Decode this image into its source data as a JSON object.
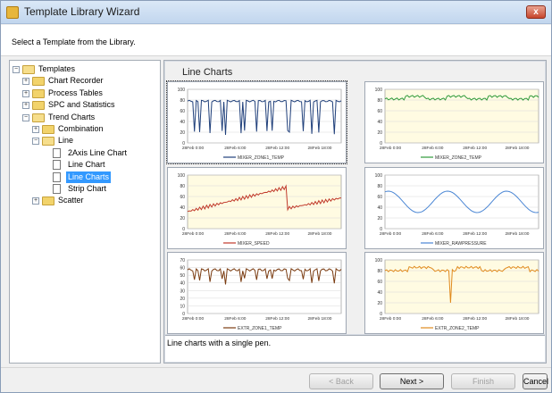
{
  "window": {
    "title": "Template Library Wizard",
    "close_glyph": "x"
  },
  "header": {
    "text": "Select a Template from the Library."
  },
  "tree": {
    "items": [
      {
        "label": "Templates",
        "level": 0,
        "expander": "−",
        "icon": "folder-open-icon"
      },
      {
        "label": "Chart Recorder",
        "level": 1,
        "expander": "+",
        "icon": "folder-icon"
      },
      {
        "label": "Process Tables",
        "level": 1,
        "expander": "+",
        "icon": "folder-icon"
      },
      {
        "label": "SPC and Statistics",
        "level": 1,
        "expander": "+",
        "icon": "folder-icon"
      },
      {
        "label": "Trend Charts",
        "level": 1,
        "expander": "−",
        "icon": "folder-open-icon"
      },
      {
        "label": "Combination",
        "level": 2,
        "expander": "+",
        "icon": "folder-icon"
      },
      {
        "label": "Line",
        "level": 2,
        "expander": "−",
        "icon": "folder-open-icon"
      },
      {
        "label": "2Axis Line Chart",
        "level": 3,
        "expander": "",
        "icon": "document-icon"
      },
      {
        "label": "Line Chart",
        "level": 3,
        "expander": "",
        "icon": "document-icon"
      },
      {
        "label": "Line Charts",
        "level": 3,
        "expander": "",
        "icon": "document-icon",
        "selected": true
      },
      {
        "label": "Strip Chart",
        "level": 3,
        "expander": "",
        "icon": "document-icon"
      },
      {
        "label": "Scatter",
        "level": 2,
        "expander": "+",
        "icon": "folder-icon"
      }
    ]
  },
  "gallery": {
    "title": "Line Charts",
    "description": "Line charts with a single pen."
  },
  "buttons": {
    "back": "< Back",
    "next": "Next >",
    "finish": "Finish",
    "cancel": "Cancel"
  },
  "chart_data": [
    {
      "type": "line",
      "pattern": "spiky-down",
      "ylim": [
        0,
        100
      ],
      "yticks": [
        "0",
        "20",
        "40",
        "60",
        "80",
        "100"
      ],
      "xticks": [
        "28Feb 0:00",
        "28Feb 6:00",
        "28Feb 12:00",
        "28Feb 18:00"
      ],
      "legend": "MIXER_ZONE1_TEMP",
      "color": "#1f3f7a",
      "base": 78,
      "low": 15,
      "bg": "#ffffff"
    },
    {
      "type": "line",
      "pattern": "steppy",
      "ylim": [
        0,
        100
      ],
      "yticks": [
        "0",
        "20",
        "40",
        "60",
        "80",
        "100"
      ],
      "xticks": [
        "28Feb 0:00",
        "28Feb 6:00",
        "28Feb 12:00",
        "28Feb 18:00"
      ],
      "legend": "MIXER_ZONE2_TEMP",
      "color": "#2e9a3a",
      "base": 82,
      "low": 78,
      "bg": "#fffbe2"
    },
    {
      "type": "line",
      "pattern": "ramp-drop",
      "ylim": [
        0,
        100
      ],
      "yticks": [
        "0",
        "20",
        "40",
        "60",
        "80",
        "100"
      ],
      "xticks": [
        "28Feb 0:00",
        "28Feb 6:00",
        "28Feb 12:00",
        "28Feb 18:00"
      ],
      "legend": "MIXER_SPEED",
      "color": "#c0392b",
      "base": 32,
      "low": 80,
      "bg": "#fffbe2"
    },
    {
      "type": "line",
      "pattern": "sine",
      "ylim": [
        0,
        100
      ],
      "yticks": [
        "0",
        "20",
        "40",
        "60",
        "80",
        "100"
      ],
      "xticks": [
        "28Feb 0:00",
        "28Feb 6:00",
        "28Feb 12:00",
        "28Feb 18:00"
      ],
      "legend": "MIXER_RAWPRESSURE",
      "color": "#4a86d4",
      "base": 60,
      "low": 40,
      "bg": "#ffffff"
    },
    {
      "type": "line",
      "pattern": "spiky-down",
      "ylim": [
        0,
        70
      ],
      "yticks": [
        "0",
        "10",
        "20",
        "30",
        "40",
        "50",
        "60",
        "70"
      ],
      "xticks": [
        "28Feb 0:00",
        "28Feb 6:00",
        "28Feb 12:00",
        "28Feb 18:00"
      ],
      "legend": "EXTR_ZONE1_TEMP",
      "color": "#7a3b10",
      "base": 57,
      "low": 38,
      "bg": "#ffffff"
    },
    {
      "type": "line",
      "pattern": "steppy-drop",
      "ylim": [
        0,
        100
      ],
      "yticks": [
        "0",
        "20",
        "40",
        "60",
        "80",
        "100"
      ],
      "xticks": [
        "28Feb 0:00",
        "28Feb 6:00",
        "28Feb 12:00",
        "28Feb 18:00"
      ],
      "legend": "EXTR_ZONE2_TEMP",
      "color": "#e08a1e",
      "base": 82,
      "low": 20,
      "bg": "#fffbe2"
    }
  ]
}
